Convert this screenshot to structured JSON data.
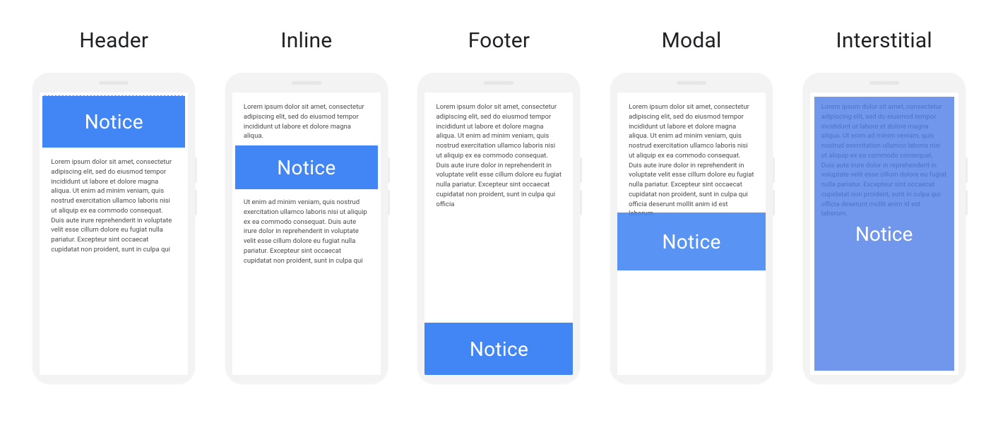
{
  "notice_label": "Notice",
  "variants": [
    {
      "key": "header",
      "title": "Header"
    },
    {
      "key": "inline",
      "title": "Inline"
    },
    {
      "key": "footer",
      "title": "Footer"
    },
    {
      "key": "modal",
      "title": "Modal"
    },
    {
      "key": "interstitial",
      "title": "Interstitial"
    }
  ],
  "lorem": {
    "header_body": "Lorem ipsum dolor sit amet, consectetur adipiscing elit, sed do eiusmod tempor incididunt ut labore et dolore magna aliqua. Ut enim ad minim veniam, quis nostrud exercitation ullamco laboris nisi ut aliquip ex ea commodo consequat. Duis aute irure reprehenderit in voluptate velit esse cillum dolore eu fugiat nulla pariatur. Excepteur sint occaecat cupidatat non proident, sunt in culpa qui",
    "inline_top": "Lorem ipsum dolor sit amet, consectetur adipiscing elit, sed do eiusmod tempor incididunt ut labore et dolore magna aliqua.",
    "inline_bottom": "Ut enim ad minim veniam, quis nostrud exercitation ullamco laboris nisi ut aliquip ex ea commodo consequat. Duis aute irure dolor in reprehenderit in voluptate velit esse cillum dolore eu fugiat nulla pariatur. Excepteur sint occaecat cupidatat non proident, sunt in culpa qui",
    "footer_body": "Lorem ipsum dolor sit amet, consectetur adipiscing elit, sed do eiusmod tempor incididunt ut labore et dolore magna aliqua. Ut enim ad minim veniam, quis nostrud exercitation ullamco laboris nisi ut aliquip ex ea commodo consequat. Duis aute irure dolor in reprehenderit in voluptate velit esse cillum dolore eu fugiat nulla pariatur. Excepteur sint occaecat cupidatat non proident, sunt in culpa qui officia",
    "modal_body": "Lorem ipsum dolor sit amet, consectetur adipiscing elit, sed do eiusmod tempor incididunt ut labore et dolore magna aliqua. Ut enim ad minim veniam, quis nostrud exercitation ullamco laboris nisi ut aliquip ex ea commodo consequat. Duis aute irure dolor in reprehenderit in voluptate velit esse cillum dolore eu fugiat nulla pariatur. Excepteur sint occaecat cupidatat non proident, sunt in culpa qui officia deserunt mollit anim id est laborum.",
    "interstitial_body": "Lorem ipsum dolor sit amet, consectetur adipiscing elit, sed do eiusmod tempor incididunt ut labore et dolore magna aliqua. Ut enim ad minim veniam, quis nostrud exercitation ullamco laboris nisi ut aliquip ex ea commodo consequat. Duis aute irure dolor in reprehenderit in voluptate velit esse cillum dolore eu fugiat nulla pariatur. Excepteur sint occaecat cupidatat non proident, sunt in culpa qui officia deserunt mollit anim id est laborum."
  },
  "colors": {
    "notice_bg": "#4285f4",
    "notice_text": "#ffffff",
    "phone_body": "#f3f3f3",
    "screen_bg": "#ffffff"
  }
}
